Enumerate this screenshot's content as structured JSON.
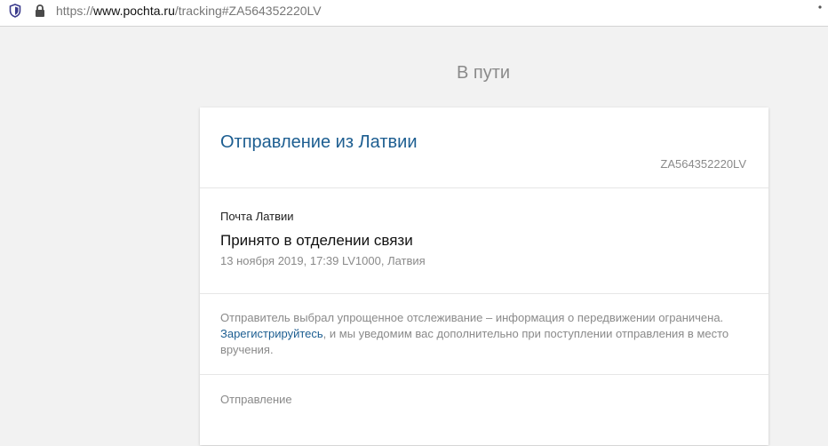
{
  "browser": {
    "url_scheme": "https://",
    "url_domain": "www.pochta.ru",
    "url_rest": "/tracking#ZA564352220LV"
  },
  "page": {
    "status_title": "В пути"
  },
  "shipment": {
    "title": "Отправление из Латвии",
    "tracking_number": "ZA564352220LV"
  },
  "event": {
    "operator": "Почта Латвии",
    "status": "Принято в отделении связи",
    "details": "13 ноября 2019, 17:39 LV1000, Латвия"
  },
  "note": {
    "text_before": "Отправитель выбрал упрощенное отслеживание – информация о передвижении ограничена.",
    "link_text": "Зарегистрируйтесь",
    "text_after": ", и мы уведомим вас дополнительно при поступлении отправления в место вручения."
  },
  "footer": {
    "label": "Отправление"
  }
}
